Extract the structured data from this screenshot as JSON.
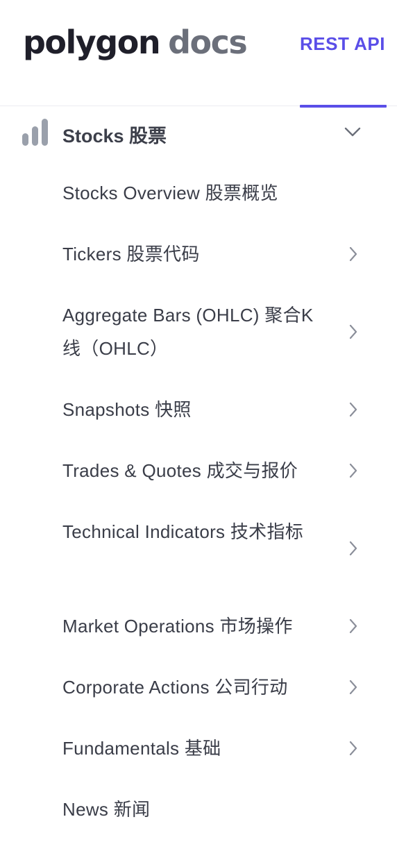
{
  "header": {
    "logo_main": "polygon",
    "logo_sub": "docs",
    "active_tab": "REST API"
  },
  "colors": {
    "accent": "#5a4ee8",
    "text": "#3a3d48",
    "icon_gray": "#9aa0ab"
  },
  "section": {
    "icon": "bar-chart-icon",
    "title": "Stocks  股票",
    "expanded": true
  },
  "nav": {
    "items": [
      {
        "label": "Stocks Overview  股票概览",
        "chevron": false
      },
      {
        "label": "Tickers  股票代码",
        "chevron": true
      },
      {
        "label": "Aggregate Bars (OHLC)  聚合K 线（OHLC）",
        "chevron": true
      },
      {
        "label": "Snapshots  快照",
        "chevron": true
      },
      {
        "label": "Trades & Quotes  成交与报价",
        "chevron": true
      },
      {
        "label": "Technical Indicators  技术指标",
        "chevron": true
      },
      {
        "label": "Market Operations  市场操作",
        "chevron": true
      },
      {
        "label": "Corporate Actions  公司行动",
        "chevron": true
      },
      {
        "label": "Fundamentals  基础",
        "chevron": true
      },
      {
        "label": "News  新闻",
        "chevron": false
      }
    ]
  }
}
